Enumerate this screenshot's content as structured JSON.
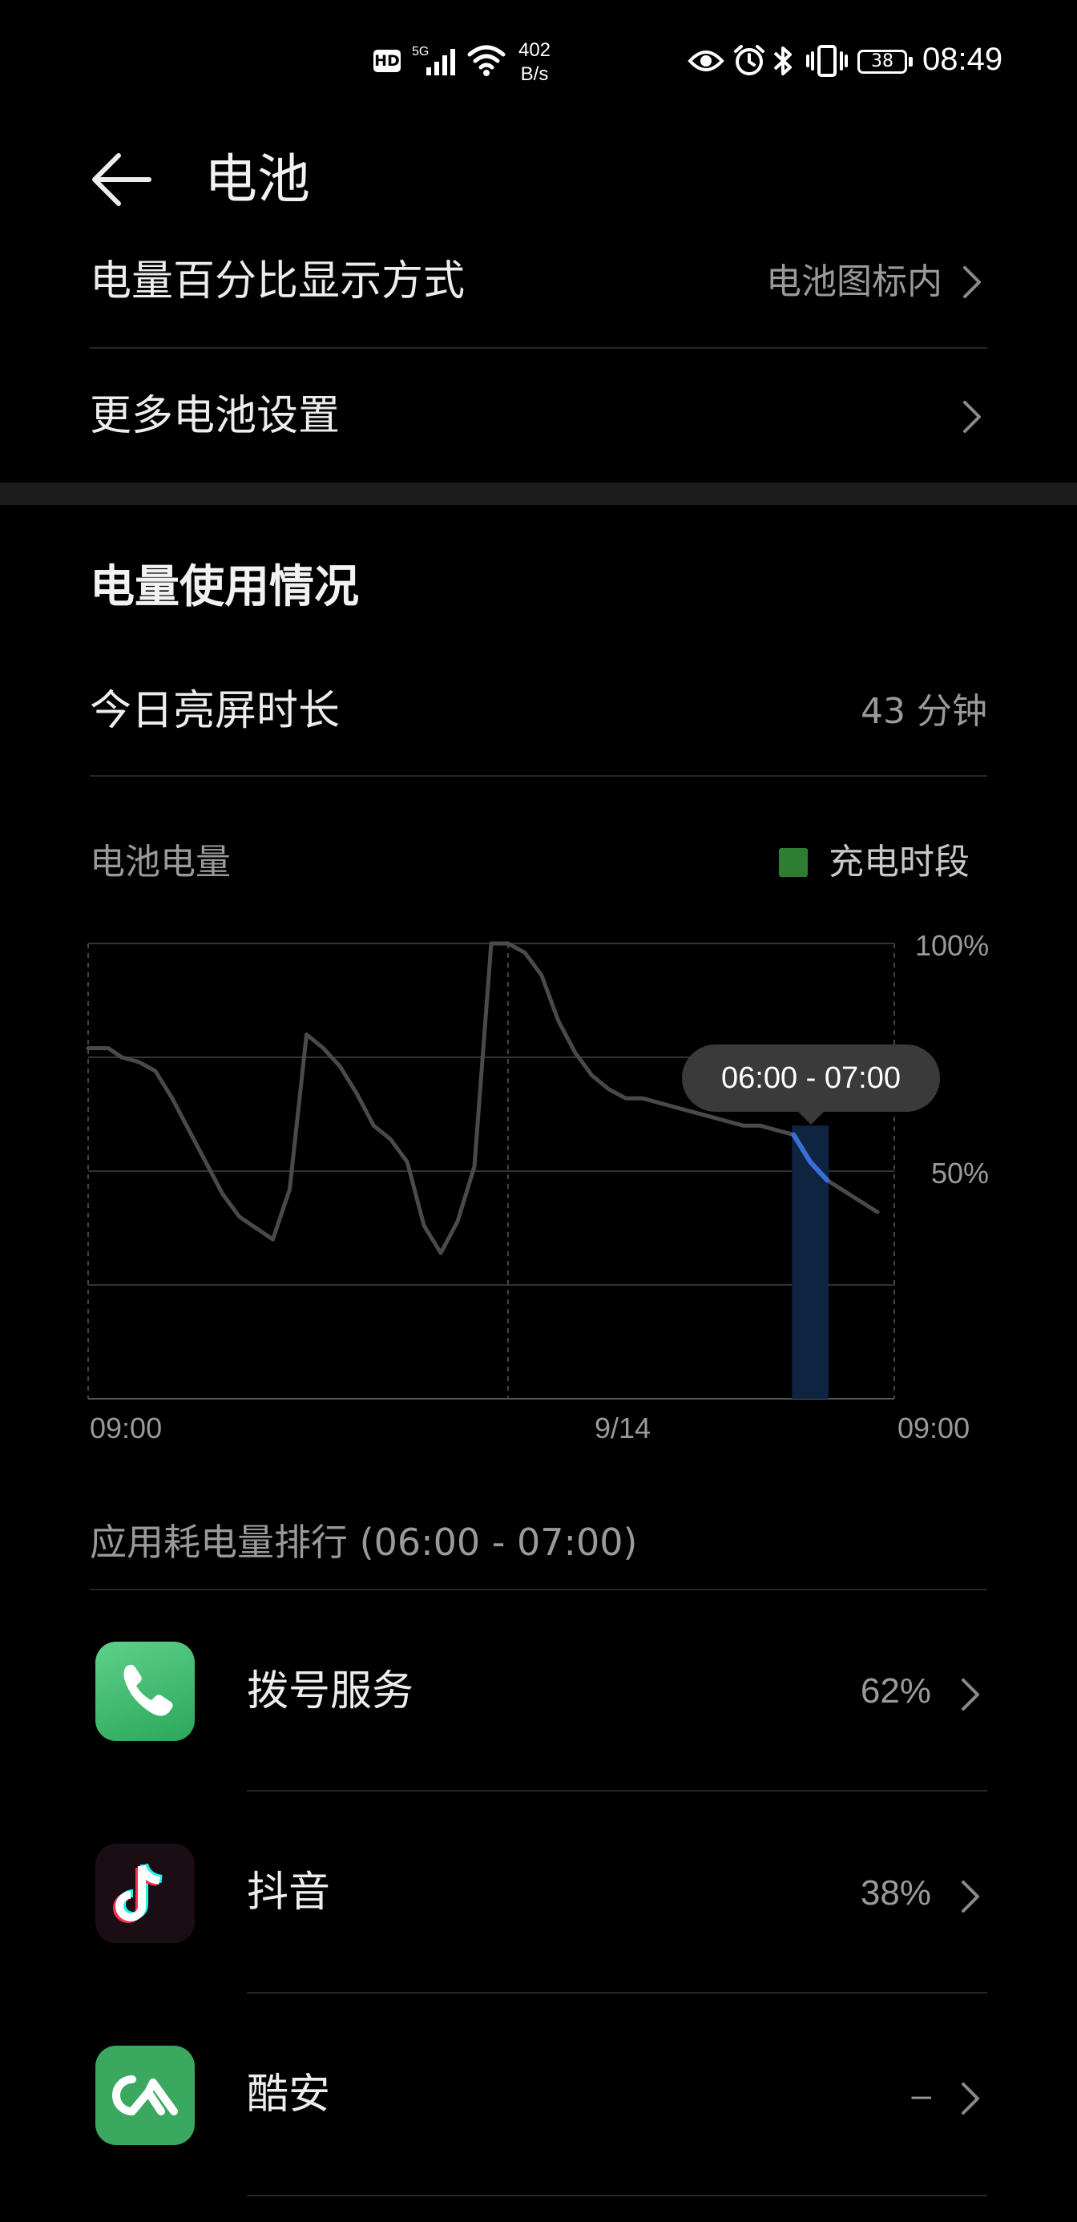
{
  "status_bar": {
    "time": "08:49",
    "net_speed_value": "402",
    "net_speed_unit": "B/s",
    "hd_label": "HD",
    "network_type": "5G",
    "battery_level": "38"
  },
  "header": {
    "title": "电池"
  },
  "settings": {
    "percentage_display_label": "电量百分比显示方式",
    "percentage_display_value": "电池图标内",
    "more_settings_label": "更多电池设置"
  },
  "usage": {
    "section_title": "电量使用情况",
    "screen_time_label": "今日亮屏时长",
    "screen_time_value": "43 分钟",
    "chart_title": "电池电量",
    "legend_charging": "充电时段",
    "tooltip": "06:00 - 07:00"
  },
  "chart_data": {
    "type": "line",
    "title": "电池电量",
    "y_tick_labels": [
      "100%",
      "50%"
    ],
    "x_tick_labels": [
      "09:00",
      "9/14",
      "09:00"
    ],
    "ylim": [
      0,
      100
    ],
    "x_range_hours": [
      0,
      24
    ],
    "series": [
      {
        "name": "",
        "points": [
          [
            0.0,
            77
          ],
          [
            0.6,
            77
          ],
          [
            1.0,
            75
          ],
          [
            1.5,
            74
          ],
          [
            2.0,
            72
          ],
          [
            2.5,
            66
          ],
          [
            3.0,
            59
          ],
          [
            3.5,
            52
          ],
          [
            4.0,
            45
          ],
          [
            4.5,
            40
          ],
          [
            5.5,
            35
          ],
          [
            6.0,
            46
          ],
          [
            6.5,
            80
          ],
          [
            7.0,
            77
          ],
          [
            7.5,
            73
          ],
          [
            8.0,
            67
          ],
          [
            8.5,
            60
          ],
          [
            9.0,
            57
          ],
          [
            9.5,
            52
          ],
          [
            10.0,
            38
          ],
          [
            10.5,
            32
          ],
          [
            11.0,
            39
          ],
          [
            11.5,
            51
          ],
          [
            12.0,
            100
          ],
          [
            12.5,
            100
          ],
          [
            13.0,
            98
          ],
          [
            13.5,
            93
          ],
          [
            14.0,
            83
          ],
          [
            14.5,
            76
          ],
          [
            15.0,
            71
          ],
          [
            15.5,
            68
          ],
          [
            16.0,
            66
          ],
          [
            16.5,
            66
          ],
          [
            17.0,
            65
          ],
          [
            17.5,
            64
          ],
          [
            18.0,
            63
          ],
          [
            18.5,
            62
          ],
          [
            19.0,
            61
          ],
          [
            19.5,
            60
          ],
          [
            20.0,
            60
          ],
          [
            20.5,
            59
          ],
          [
            21.0,
            58
          ],
          [
            21.5,
            52
          ],
          [
            22.0,
            48
          ],
          [
            23.5,
            41
          ]
        ]
      }
    ],
    "highlight": {
      "label": "06:00 - 07:00",
      "x_start": 21.0,
      "x_end": 22.0,
      "color": "#3a6fd8"
    },
    "grid": true,
    "legend": "top-right"
  },
  "ranking": {
    "title": "应用耗电量排行 (06:00 - 07:00)",
    "apps": [
      {
        "name": "拨号服务",
        "percent": "62%",
        "icon": "phone-icon",
        "color": "#3dbb6f"
      },
      {
        "name": "抖音",
        "percent": "38%",
        "icon": "douyin-icon",
        "color": "#1a0e14"
      },
      {
        "name": "酷安",
        "percent": "–",
        "icon": "coolapk-icon",
        "color": "#3aa85e"
      }
    ]
  }
}
